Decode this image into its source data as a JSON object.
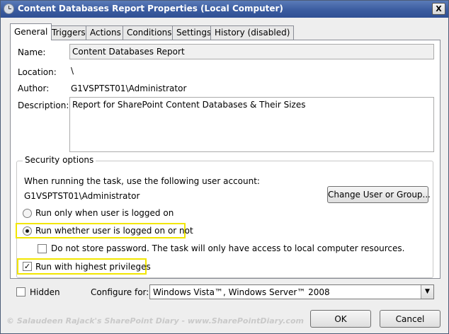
{
  "window": {
    "title": "Content Databases Report Properties (Local Computer)",
    "close_label": "X"
  },
  "tabs": [
    {
      "label": "General",
      "active": true
    },
    {
      "label": "Triggers",
      "active": false
    },
    {
      "label": "Actions",
      "active": false
    },
    {
      "label": "Conditions",
      "active": false
    },
    {
      "label": "Settings",
      "active": false
    },
    {
      "label": "History (disabled)",
      "active": false
    }
  ],
  "general": {
    "name_label": "Name:",
    "name_value": "Content Databases Report",
    "location_label": "Location:",
    "location_value": "\\",
    "author_label": "Author:",
    "author_value": "G1VSPTST01\\Administrator",
    "description_label": "Description:",
    "description_value": "Report for SharePoint Content Databases & Their Sizes"
  },
  "security": {
    "group_title": "Security options",
    "account_prompt": "When running the task, use the following user account:",
    "account_value": "G1VSPTST01\\Administrator",
    "change_button": "Change User or Group...",
    "radio_logged_on": {
      "label": "Run only when user is logged on",
      "checked": false
    },
    "radio_whether": {
      "label": "Run whether user is logged on or not",
      "checked": true
    },
    "no_store_password": {
      "label": "Do not store password.  The task will only have access to local computer resources.",
      "checked": false
    },
    "highest_privileges": {
      "label": "Run with highest privileges",
      "checked": true
    }
  },
  "bottom": {
    "hidden_label": "Hidden",
    "hidden_checked": false,
    "configure_label": "Configure for:",
    "configure_value": "Windows Vista™, Windows Server™ 2008"
  },
  "buttons": {
    "ok": "OK",
    "cancel": "Cancel"
  },
  "watermark": "© Salaudeen Rajack's SharePoint Diary - www.SharePointDiary.com",
  "colors": {
    "highlight": "#f2e600",
    "titlebar": "#3b5ca0"
  }
}
